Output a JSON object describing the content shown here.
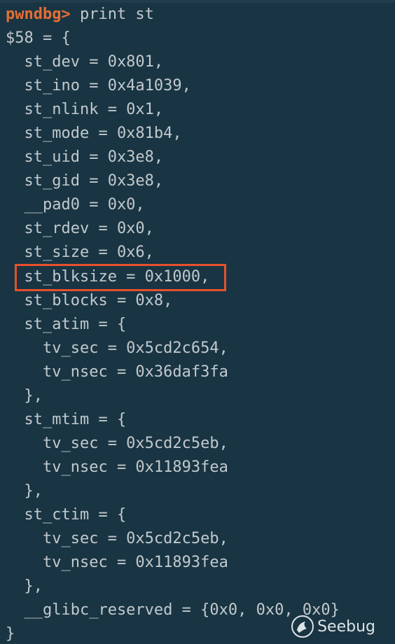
{
  "prompt": "pwndbg>",
  "command": " print st",
  "lines": [
    "$58 = {",
    "  st_dev = 0x801,",
    "  st_ino = 0x4a1039,",
    "  st_nlink = 0x1,",
    "  st_mode = 0x81b4,",
    "  st_uid = 0x3e8,",
    "  st_gid = 0x3e8,",
    "  __pad0 = 0x0,",
    "  st_rdev = 0x0,",
    "  st_size = 0x6,",
    "  st_blksize = 0x1000,",
    "  st_blocks = 0x8,",
    "  st_atim = {",
    "    tv_sec = 0x5cd2c654,",
    "    tv_nsec = 0x36daf3fa",
    "  },",
    "  st_mtim = {",
    "    tv_sec = 0x5cd2c5eb,",
    "    tv_nsec = 0x11893fea",
    "  },",
    "  st_ctim = {",
    "    tv_sec = 0x5cd2c5eb,",
    "    tv_nsec = 0x11893fea",
    "  },",
    "  __glibc_reserved = {0x0, 0x0, 0x0}",
    "}"
  ],
  "watermark": "Seebug",
  "colors": {
    "background": "#193543",
    "text": "#c2c9cd",
    "prompt": "#e66e35",
    "highlight_border": "#e8502d"
  },
  "icons": {
    "watermark_logo": "seebug-logo-icon"
  }
}
